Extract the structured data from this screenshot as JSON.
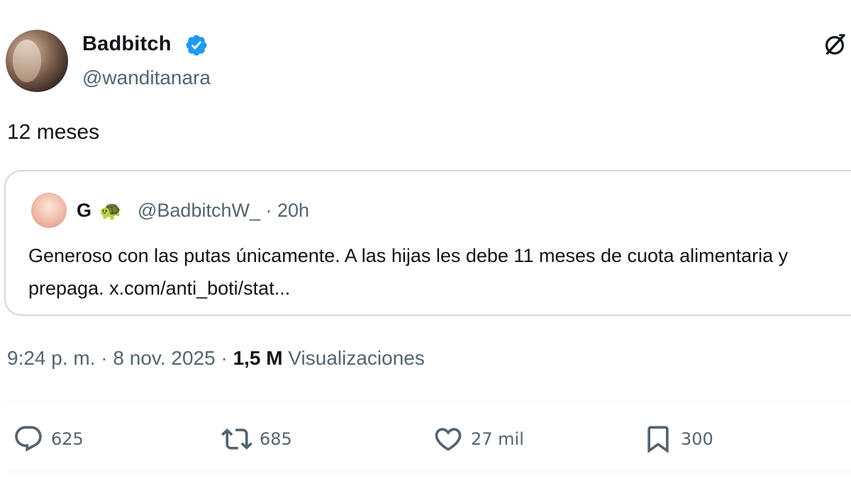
{
  "author": {
    "display_name": "Badbitch",
    "handle": "@wanditanara",
    "verified": true
  },
  "tweet": {
    "text": "12 meses"
  },
  "quoted_tweet": {
    "name": "G",
    "emoji": "🐢",
    "handle": "@BadbitchW_",
    "separator": "·",
    "time": "20h",
    "text": "Generoso con las putas únicamente. A las hijas les debe 11 meses de cuota alimentaria y prepaga. x.com/anti_boti/stat..."
  },
  "meta": {
    "time": "9:24 p. m.",
    "sep1": "·",
    "date": "8 nov. 2025",
    "sep2": "·",
    "views_count": "1,5 M",
    "views_label": "Visualizaciones"
  },
  "actions": {
    "replies": "625",
    "reposts": "685",
    "likes": "27 mil",
    "bookmarks": "300"
  },
  "icons": {
    "verified": "verified-badge-icon",
    "grok": "grok-icon",
    "reply": "reply-icon",
    "repost": "repost-icon",
    "like": "heart-icon",
    "bookmark": "bookmark-icon"
  },
  "colors": {
    "accent": "#1d9bf0",
    "text": "#0f1419",
    "secondary": "#536471",
    "border": "#cfd9de"
  }
}
